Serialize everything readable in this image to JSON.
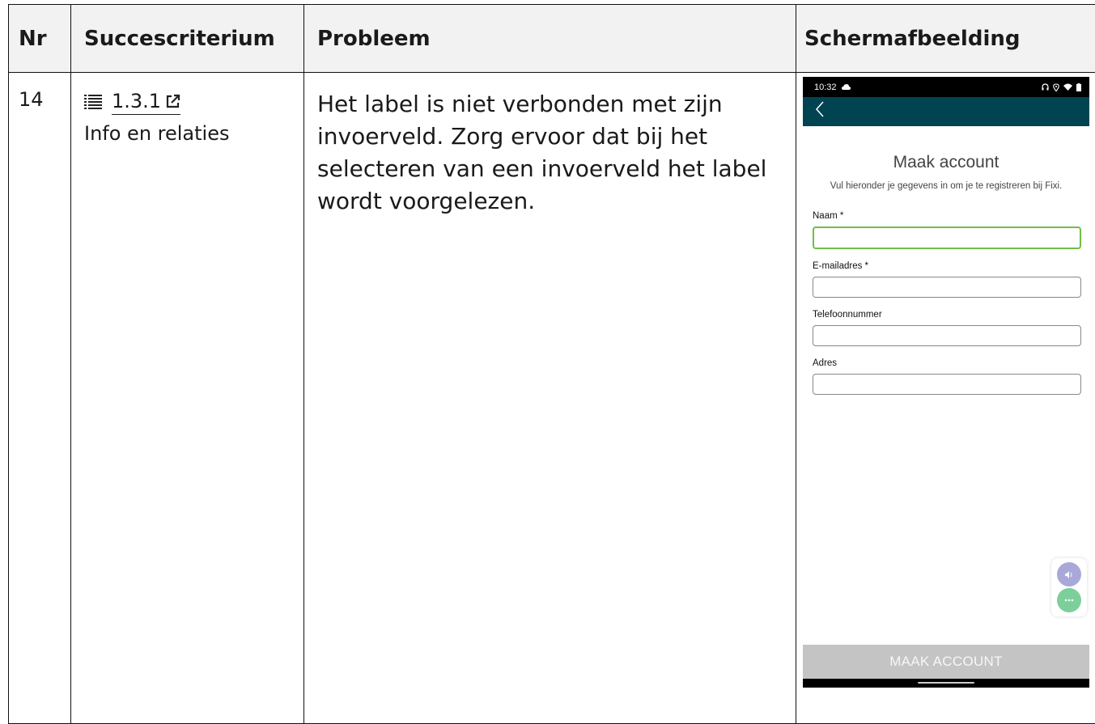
{
  "table": {
    "headers": {
      "nr": "Nr",
      "criterion": "Succescriterium",
      "problem": "Probleem",
      "screenshot": "Schermafbeelding"
    },
    "row": {
      "nr": "14",
      "criterion_code": "1.3.1",
      "criterion_name": "Info en relaties",
      "problem": "Het label is niet verbonden met zijn invoerveld. Zorg ervoor dat bij het selecteren van een invoerveld het label wordt voorgelezen."
    }
  },
  "phone": {
    "status_time": "10:32",
    "title": "Maak account",
    "subtitle": "Vul hieronder je gegevens in om je te registreren bij Fixi.",
    "fields": [
      {
        "label": "Naam *",
        "value": "",
        "focused": true
      },
      {
        "label": "E-mailadres *",
        "value": "",
        "focused": false
      },
      {
        "label": "Telefoonnummer",
        "value": "",
        "focused": false
      },
      {
        "label": "Adres",
        "value": "",
        "focused": false
      }
    ],
    "button_label": "MAAK ACCOUNT",
    "colors": {
      "appbar": "#004452",
      "focus_border": "#6cbf4a",
      "button_bg": "#c4c4c4",
      "fab_speak": "#a9a8d9",
      "fab_more": "#7ccf9a"
    },
    "icons": [
      "back-icon",
      "cloud-icon",
      "headset-icon",
      "location-icon",
      "wifi-icon",
      "battery-icon",
      "speaker-icon",
      "more-icon"
    ]
  }
}
